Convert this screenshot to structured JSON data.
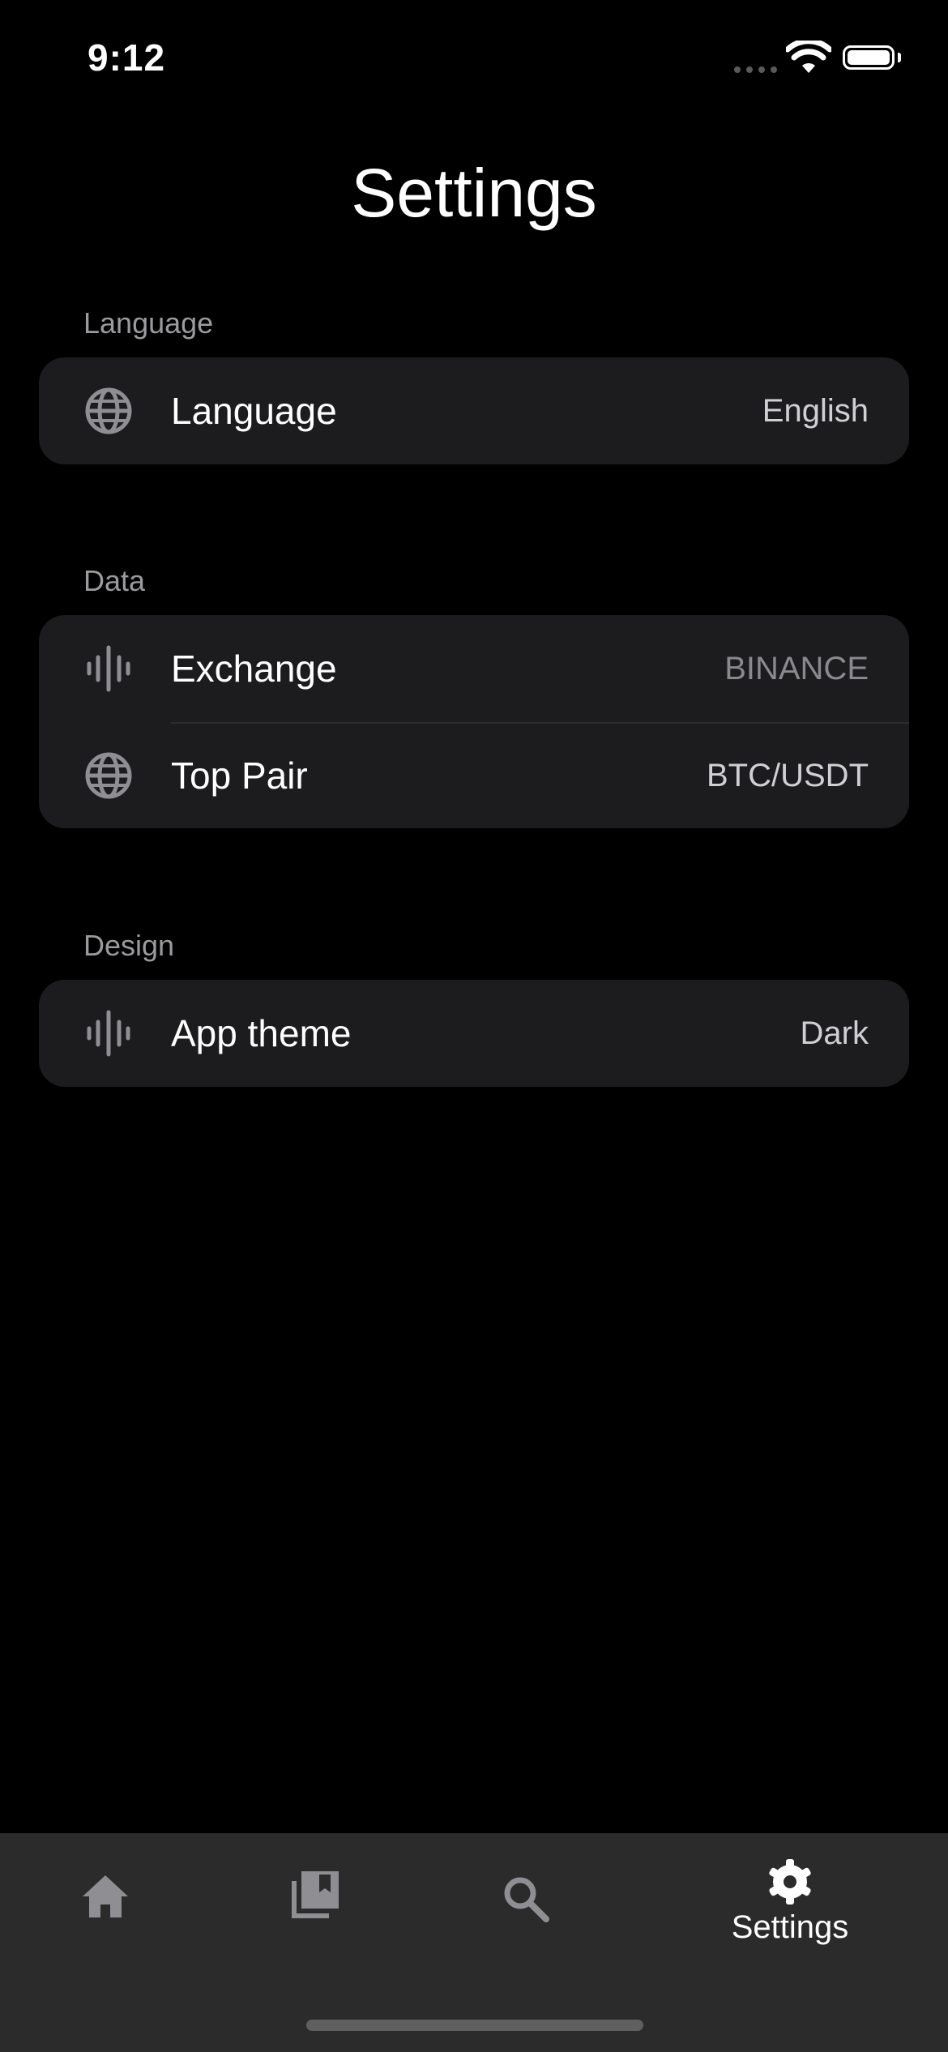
{
  "status_bar": {
    "time": "9:12"
  },
  "header": {
    "title": "Settings"
  },
  "sections": {
    "language": {
      "label": "Language",
      "rows": [
        {
          "label": "Language",
          "value": "English",
          "icon": "globe-icon"
        }
      ]
    },
    "data": {
      "label": "Data",
      "rows": [
        {
          "label": "Exchange",
          "value": "BINANCE",
          "icon": "waveform-icon"
        },
        {
          "label": "Top Pair",
          "value": "BTC/USDT",
          "icon": "globe-icon"
        }
      ]
    },
    "design": {
      "label": "Design",
      "rows": [
        {
          "label": "App theme",
          "value": "Dark",
          "icon": "waveform-icon"
        }
      ]
    }
  },
  "tab_bar": {
    "tabs": [
      {
        "icon": "home-icon",
        "label": ""
      },
      {
        "icon": "library-icon",
        "label": ""
      },
      {
        "icon": "search-icon",
        "label": ""
      },
      {
        "icon": "gear-icon",
        "label": "Settings",
        "active": true
      }
    ]
  },
  "colors": {
    "background": "#000000",
    "card": "#1c1c1e",
    "tab_bar": "#2b2b2b",
    "icon": "#8e8e93"
  }
}
